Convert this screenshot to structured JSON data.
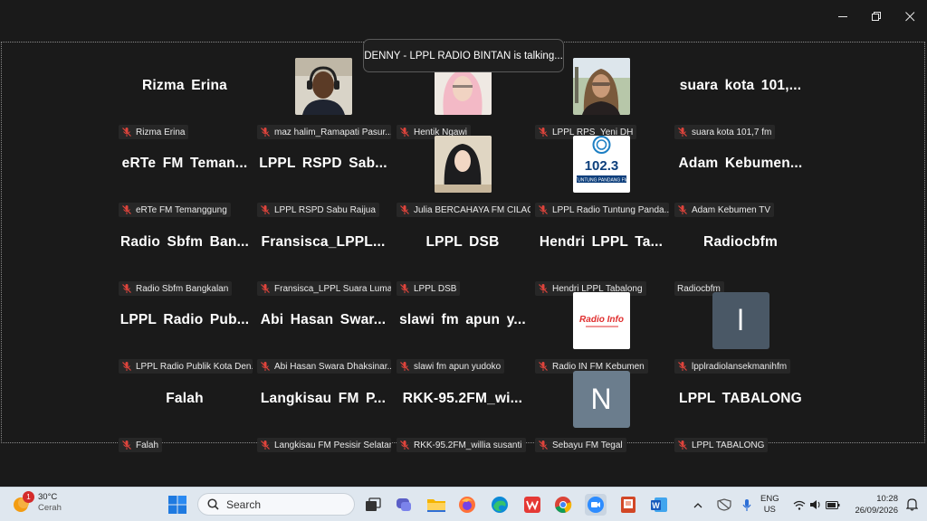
{
  "window": {
    "controls": [
      "minimize",
      "maximize",
      "close"
    ]
  },
  "banner": {
    "talking": "DENNY - LPPL RADIO BINTAN is talking..."
  },
  "tiles": [
    {
      "big": "Rizma Erina",
      "label": "Rizma Erina",
      "muted": true
    },
    {
      "big": "",
      "label": "maz halim_Ramapati Pasur...",
      "muted": true,
      "video": "man-headset"
    },
    {
      "big": "",
      "label": "Hentik Ngawi",
      "muted": true,
      "video": "woman-pink"
    },
    {
      "big": "",
      "label": "LPPL RPS_Yeni DH",
      "muted": true,
      "video": "woman-hijab-outdoor"
    },
    {
      "big": "suara kota 101,...",
      "label": "suara kota 101,7 fm",
      "muted": true
    },
    {
      "big": "eRTe FM Teman...",
      "label": "eRTe FM Temanggung",
      "muted": true
    },
    {
      "big": "LPPL RSPD Sab...",
      "label": "LPPL RSPD Sabu Raijua",
      "muted": true
    },
    {
      "big": "",
      "label": "Julia BERCAHAYA FM CILAC...",
      "muted": true,
      "video": "woman-black-hijab"
    },
    {
      "big": "",
      "label": "LPPL Radio Tuntung Panda...",
      "muted": true,
      "video": "logo-1023",
      "logo_text": "102.3",
      "logo_sub": "TUNTUNG PANDANG FM"
    },
    {
      "big": "Adam Kebumen...",
      "label": "Adam Kebumen TV",
      "muted": true
    },
    {
      "big": "Radio Sbfm Ban...",
      "label": "Radio Sbfm Bangkalan",
      "muted": true
    },
    {
      "big": "Fransisca_LPPL...",
      "label": "Fransisca_LPPL Suara Luma...",
      "muted": true
    },
    {
      "big": "LPPL DSB",
      "label": "LPPL DSB",
      "muted": true
    },
    {
      "big": "Hendri LPPL Ta...",
      "label": "Hendri LPPL Tabalong",
      "muted": true
    },
    {
      "big": "Radiocbfm",
      "label": "Radiocbfm",
      "muted": false
    },
    {
      "big": "LPPL Radio Pub...",
      "label": "LPPL Radio Publik Kota Den...",
      "muted": true
    },
    {
      "big": "Abi Hasan Swar...",
      "label": "Abi Hasan Swara Dhaksinar...",
      "muted": true
    },
    {
      "big": "slawi fm apun y...",
      "label": "slawi fm apun yudoko",
      "muted": true
    },
    {
      "big": "",
      "label": "Radio IN FM Kebumen",
      "muted": true,
      "video": "logo-radioinfo",
      "logo_text": "Radio Info"
    },
    {
      "big": "",
      "label": "lpplradiolansekmanihfm",
      "muted": true,
      "letter": "l"
    },
    {
      "big": "Falah",
      "label": "Falah",
      "muted": true
    },
    {
      "big": "Langkisau FM P...",
      "label": "Langkisau FM Pesisir Selatan",
      "muted": true
    },
    {
      "big": "RKK-95.2FM_wi...",
      "label": "RKK-95.2FM_willia susanti",
      "muted": true
    },
    {
      "big": "",
      "label": "Sebayu FM Tegal",
      "muted": true,
      "letter": "N"
    },
    {
      "big": "LPPL TABALONG",
      "label": "LPPL TABALONG",
      "muted": true
    }
  ],
  "taskbar": {
    "weather": {
      "temp": "30°C",
      "condition": "Cerah",
      "badge": "1"
    },
    "search_placeholder": "Search",
    "apps": [
      "task-view",
      "chat",
      "file-explorer",
      "firefox",
      "edge",
      "wps-office",
      "chrome",
      "zoom",
      "powerpoint",
      "word"
    ],
    "lang": {
      "line1": "ENG",
      "line2": "US"
    },
    "clock": {
      "time": "10:28",
      "date": "26/09/2026"
    }
  },
  "colors": {
    "bg": "#1a1a1a",
    "mic_muted": "#e0443c",
    "taskbar": "#dfe7ef"
  }
}
